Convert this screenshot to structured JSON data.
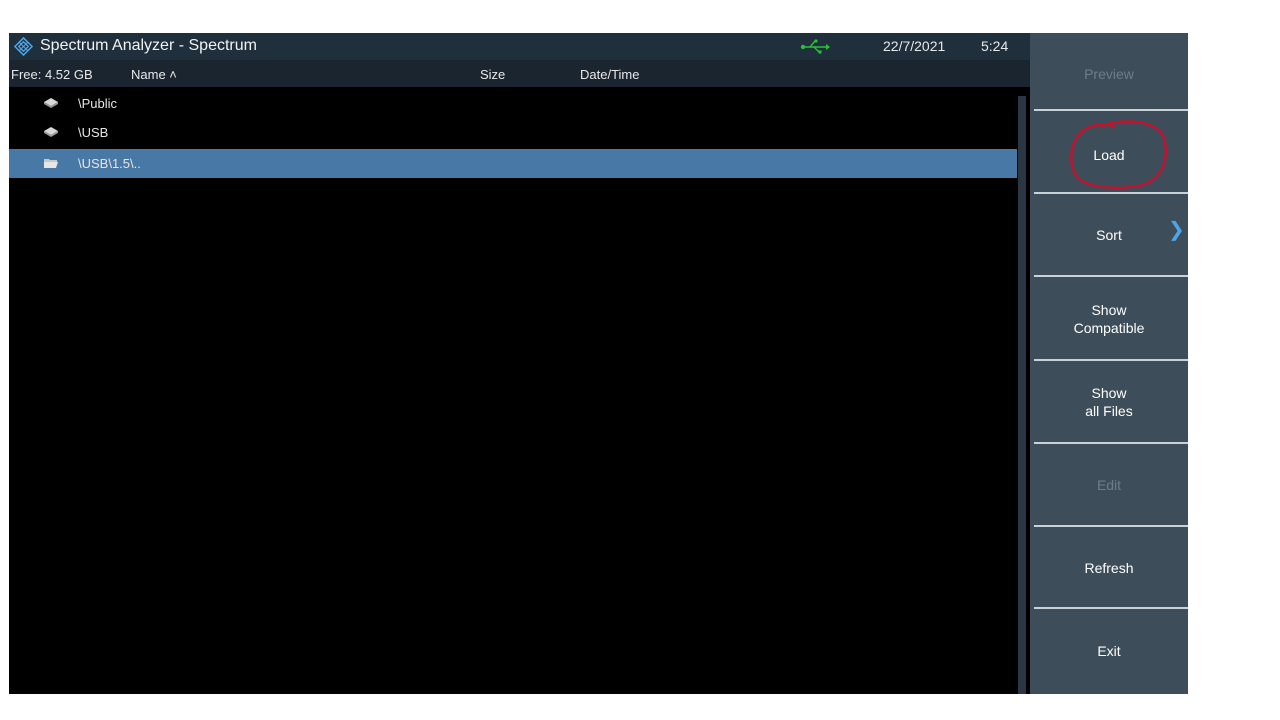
{
  "title_bar": {
    "title": "Spectrum Analyzer - Spectrum",
    "date": "22/7/2021",
    "time": "5:24",
    "usb_icon": "usb-icon",
    "logo_icon": "rohde-schwarz-logo"
  },
  "columns": {
    "free_space": "Free: 4.52 GB",
    "name": "Name ˄",
    "size": "Size",
    "datetime": "Date/Time"
  },
  "files": [
    {
      "label": "\\Public",
      "icon": "drive-icon",
      "selected": false
    },
    {
      "label": "\\USB",
      "icon": "drive-icon",
      "selected": false
    },
    {
      "label": "\\USB\\1.5\\..",
      "icon": "folder-open-icon",
      "selected": true
    }
  ],
  "softkeys": {
    "preview": "Preview",
    "load": "Load",
    "sort": "Sort",
    "show_compatible_1": "Show",
    "show_compatible_2": "Compatible",
    "show_all_1": "Show",
    "show_all_2": "all Files",
    "edit": "Edit",
    "refresh": "Refresh",
    "exit": "Exit"
  },
  "colors": {
    "title_bar": "#1f2f3c",
    "selected_row": "#4878a6",
    "softkey_panel": "#3d4d59",
    "annotation": "#c8102e",
    "usb_indicator": "#2bbf3a"
  }
}
